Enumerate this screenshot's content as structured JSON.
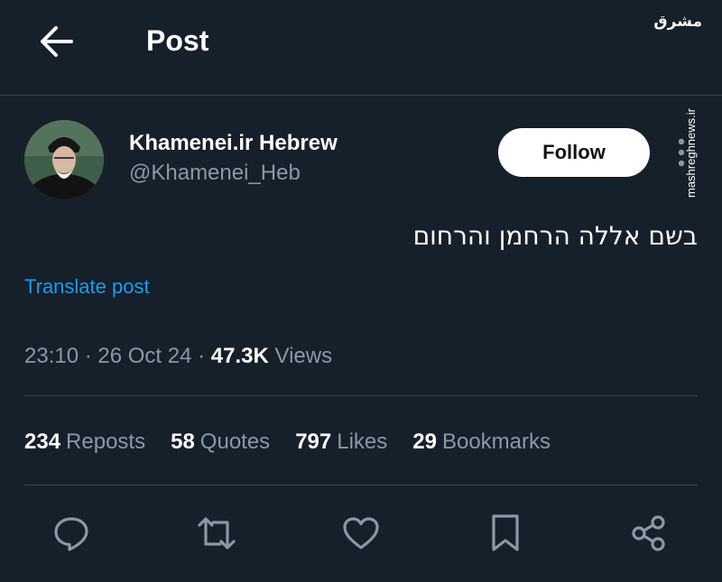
{
  "header": {
    "title": "Post",
    "back_icon": "arrow-left-icon"
  },
  "watermark": {
    "logo_text": "مشرق",
    "url": "mashreghnews.ir"
  },
  "author": {
    "display_name": "Khamenei.ir Hebrew",
    "handle": "@Khamenei_Heb",
    "avatar_icon": "avatar-portrait"
  },
  "follow_label": "Follow",
  "post": {
    "text": "בשם אללה הרחמן והרחום",
    "translate_label": "Translate post",
    "time": "23:10",
    "date": "26 Oct 24",
    "separator": " · ",
    "views_count": "47.3K",
    "views_label": "Views"
  },
  "stats": [
    {
      "count": "234",
      "label": "Reposts"
    },
    {
      "count": "58",
      "label": "Quotes"
    },
    {
      "count": "797",
      "label": "Likes"
    },
    {
      "count": "29",
      "label": "Bookmarks"
    }
  ],
  "actions": [
    "reply-icon",
    "repost-icon",
    "like-icon",
    "bookmark-icon",
    "share-icon"
  ],
  "colors": {
    "background": "#15202b",
    "link": "#1d9bf0",
    "secondary_text": "#8b98a5",
    "divider": "#38444d"
  }
}
